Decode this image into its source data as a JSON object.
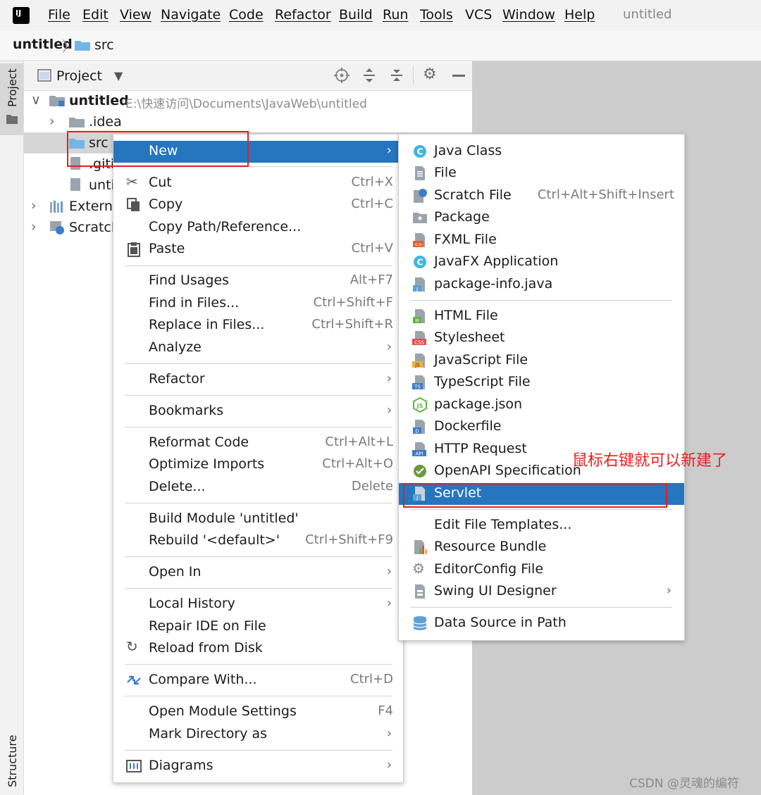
{
  "menubar": {
    "items": [
      "File",
      "Edit",
      "View",
      "Navigate",
      "Code",
      "Refactor",
      "Build",
      "Run",
      "Tools",
      "VCS",
      "Window",
      "Help"
    ],
    "window_title": "untitled"
  },
  "breadcrumb": {
    "project": "untitled",
    "folder": "src"
  },
  "toolwindow": {
    "project_tab": "Project",
    "structure_tab": "Structure",
    "header_title": "Project"
  },
  "tree": {
    "root_label": "untitled",
    "root_path": "E:\\快速访问\\Documents\\JavaWeb\\untitled",
    "idea": ".idea",
    "src": "src",
    "gitignore": ".giti",
    "iml": "unti",
    "external": "Externa",
    "scratches": "Scratch"
  },
  "context_menu": {
    "items": [
      {
        "label": "New",
        "shortcut": ""
      },
      {
        "label": "Cut",
        "shortcut": "Ctrl+X"
      },
      {
        "label": "Copy",
        "shortcut": "Ctrl+C"
      },
      {
        "label": "Copy Path/Reference...",
        "shortcut": ""
      },
      {
        "label": "Paste",
        "shortcut": "Ctrl+V"
      },
      {
        "label": "Find Usages",
        "shortcut": "Alt+F7"
      },
      {
        "label": "Find in Files...",
        "shortcut": "Ctrl+Shift+F"
      },
      {
        "label": "Replace in Files...",
        "shortcut": "Ctrl+Shift+R"
      },
      {
        "label": "Analyze",
        "shortcut": ""
      },
      {
        "label": "Refactor",
        "shortcut": ""
      },
      {
        "label": "Bookmarks",
        "shortcut": ""
      },
      {
        "label": "Reformat Code",
        "shortcut": "Ctrl+Alt+L"
      },
      {
        "label": "Optimize Imports",
        "shortcut": "Ctrl+Alt+O"
      },
      {
        "label": "Delete...",
        "shortcut": "Delete"
      },
      {
        "label": "Build Module 'untitled'",
        "shortcut": ""
      },
      {
        "label": "Rebuild '<default>'",
        "shortcut": "Ctrl+Shift+F9"
      },
      {
        "label": "Open In",
        "shortcut": ""
      },
      {
        "label": "Local History",
        "shortcut": ""
      },
      {
        "label": "Repair IDE on File",
        "shortcut": ""
      },
      {
        "label": "Reload from Disk",
        "shortcut": ""
      },
      {
        "label": "Compare With...",
        "shortcut": "Ctrl+D"
      },
      {
        "label": "Open Module Settings",
        "shortcut": "F4"
      },
      {
        "label": "Mark Directory as",
        "shortcut": ""
      },
      {
        "label": "Diagrams",
        "shortcut": ""
      }
    ]
  },
  "new_submenu": {
    "items": [
      {
        "label": "Java Class",
        "shortcut": ""
      },
      {
        "label": "File",
        "shortcut": ""
      },
      {
        "label": "Scratch File",
        "shortcut": "Ctrl+Alt+Shift+Insert"
      },
      {
        "label": "Package",
        "shortcut": ""
      },
      {
        "label": "FXML File",
        "shortcut": ""
      },
      {
        "label": "JavaFX Application",
        "shortcut": ""
      },
      {
        "label": "package-info.java",
        "shortcut": ""
      },
      {
        "label": "HTML File",
        "shortcut": ""
      },
      {
        "label": "Stylesheet",
        "shortcut": ""
      },
      {
        "label": "JavaScript File",
        "shortcut": ""
      },
      {
        "label": "TypeScript File",
        "shortcut": ""
      },
      {
        "label": "package.json",
        "shortcut": ""
      },
      {
        "label": "Dockerfile",
        "shortcut": ""
      },
      {
        "label": "HTTP Request",
        "shortcut": ""
      },
      {
        "label": "OpenAPI Specification",
        "shortcut": ""
      },
      {
        "label": "Servlet",
        "shortcut": ""
      },
      {
        "label": "Edit File Templates...",
        "shortcut": ""
      },
      {
        "label": "Resource Bundle",
        "shortcut": ""
      },
      {
        "label": "EditorConfig File",
        "shortcut": ""
      },
      {
        "label": "Swing UI Designer",
        "shortcut": ""
      },
      {
        "label": "Data Source in Path",
        "shortcut": ""
      }
    ]
  },
  "annotation": "鼠标右键就可以新建了",
  "watermark": "CSDN @灵魂的编符",
  "icons": {
    "badges": {
      "fxml": "<>",
      "html": "H",
      "css": "CSS",
      "js": "JS",
      "ts": "TS",
      "docker": "D",
      "api": "API",
      "servlet": "J",
      "pkginfo": "J",
      "class": "C"
    }
  },
  "colors": {
    "selection": "#2675bf",
    "highlight_box": "#e02020",
    "annotation": "#e8201c"
  }
}
